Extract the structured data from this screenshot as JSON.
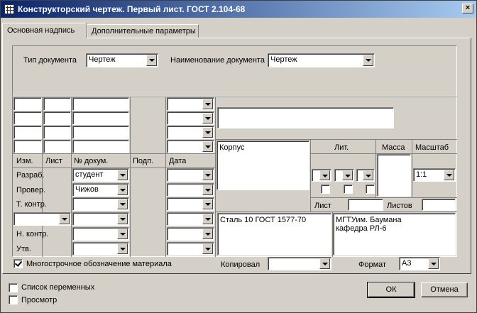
{
  "window": {
    "title": "Конструкторский чертеж. Первый лист. ГОСТ 2.104-68"
  },
  "tabs": [
    {
      "label": "Основная надпись",
      "active": true
    },
    {
      "label": "Дополнительные параметры",
      "active": false
    }
  ],
  "top": {
    "doc_type_label": "Тип документа",
    "doc_type_value": "Чертеж",
    "doc_name_label": "Наименование документа",
    "doc_name_value": "Чертеж"
  },
  "stamp": {
    "headers": {
      "izm": "Изм.",
      "list": "Лист",
      "ndoc": "№ докум.",
      "podp": "Подп.",
      "data": "Дата"
    },
    "roles": [
      {
        "label": "Разраб.",
        "name": "студент"
      },
      {
        "label": "Провер.",
        "name": "Чижов"
      },
      {
        "label": "Т. контр.",
        "name": ""
      },
      {
        "label": "",
        "name": ""
      },
      {
        "label": "Н. контр.",
        "name": ""
      },
      {
        "label": "Утв.",
        "name": ""
      }
    ],
    "designation": "",
    "part_name": "Корпус",
    "material": "Сталь 10 ГОСТ 1577-70",
    "organization": "МГТУим. Баумана\nкафедра РЛ-6",
    "lit_label": "Лит.",
    "mass_label": "Масса",
    "scale_label": "Масштаб",
    "scale_value": "1:1",
    "sheet_label": "Лист",
    "sheets_label": "Листов"
  },
  "options": {
    "multiline_material_label": "Многострочное обозначение материала",
    "multiline_material_checked": true,
    "copied_label": "Копировал",
    "format_label": "Формат",
    "format_value": "А3"
  },
  "bottom": {
    "variables_label": "Список переменных",
    "preview_label": "Просмотр",
    "ok_label": "ОК",
    "cancel_label": "Отмена"
  }
}
